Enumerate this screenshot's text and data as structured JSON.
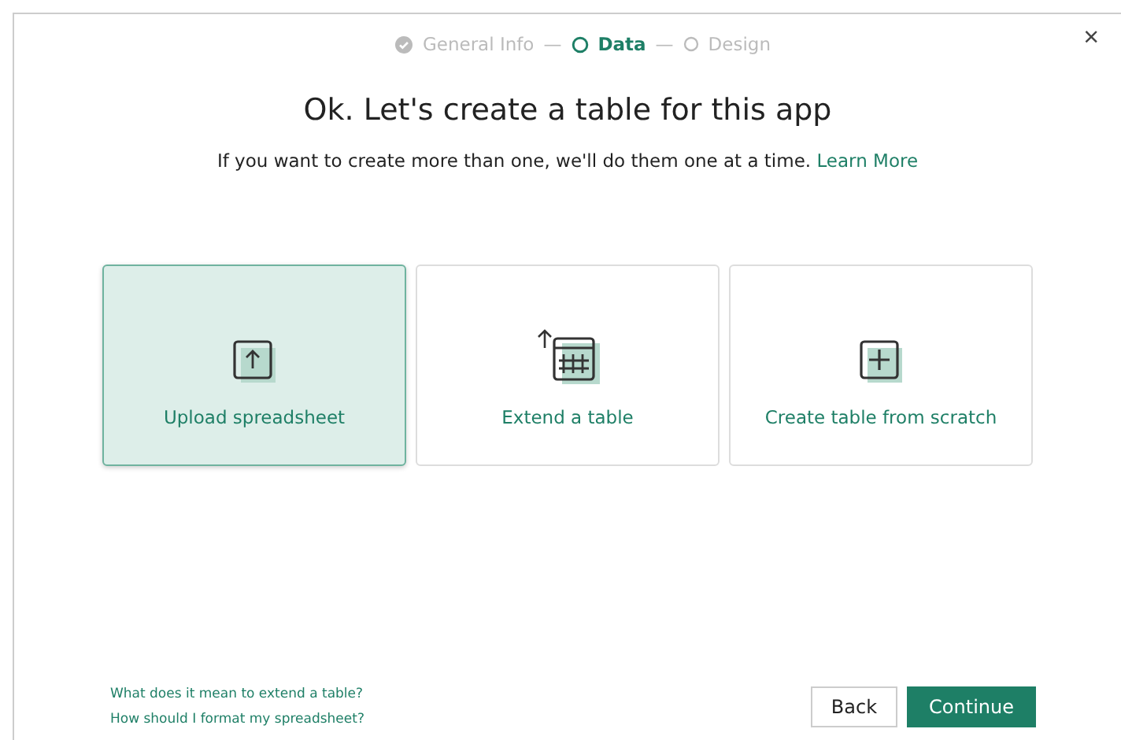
{
  "steps": [
    {
      "label": "General Info",
      "kind": "done"
    },
    {
      "label": "Data",
      "kind": "current"
    },
    {
      "label": "Design",
      "kind": "pending"
    }
  ],
  "step_separator": "—",
  "close": "×",
  "title": "Ok. Let's create a table for this app",
  "subtitle": "If you want to create more than one, we'll do them one at a time.",
  "learn_more": "Learn More",
  "options": [
    {
      "label": "Upload spreadsheet",
      "kind": "upload",
      "selected": true
    },
    {
      "label": "Extend a table",
      "kind": "extend",
      "selected": false
    },
    {
      "label": "Create table from scratch",
      "kind": "create",
      "selected": false
    }
  ],
  "help_links": [
    "What does it mean to extend a table?",
    "How should I format my spreadsheet?"
  ],
  "buttons": [
    {
      "label": "Back",
      "kind": "secondary"
    },
    {
      "label": "Continue",
      "kind": "primary"
    }
  ]
}
